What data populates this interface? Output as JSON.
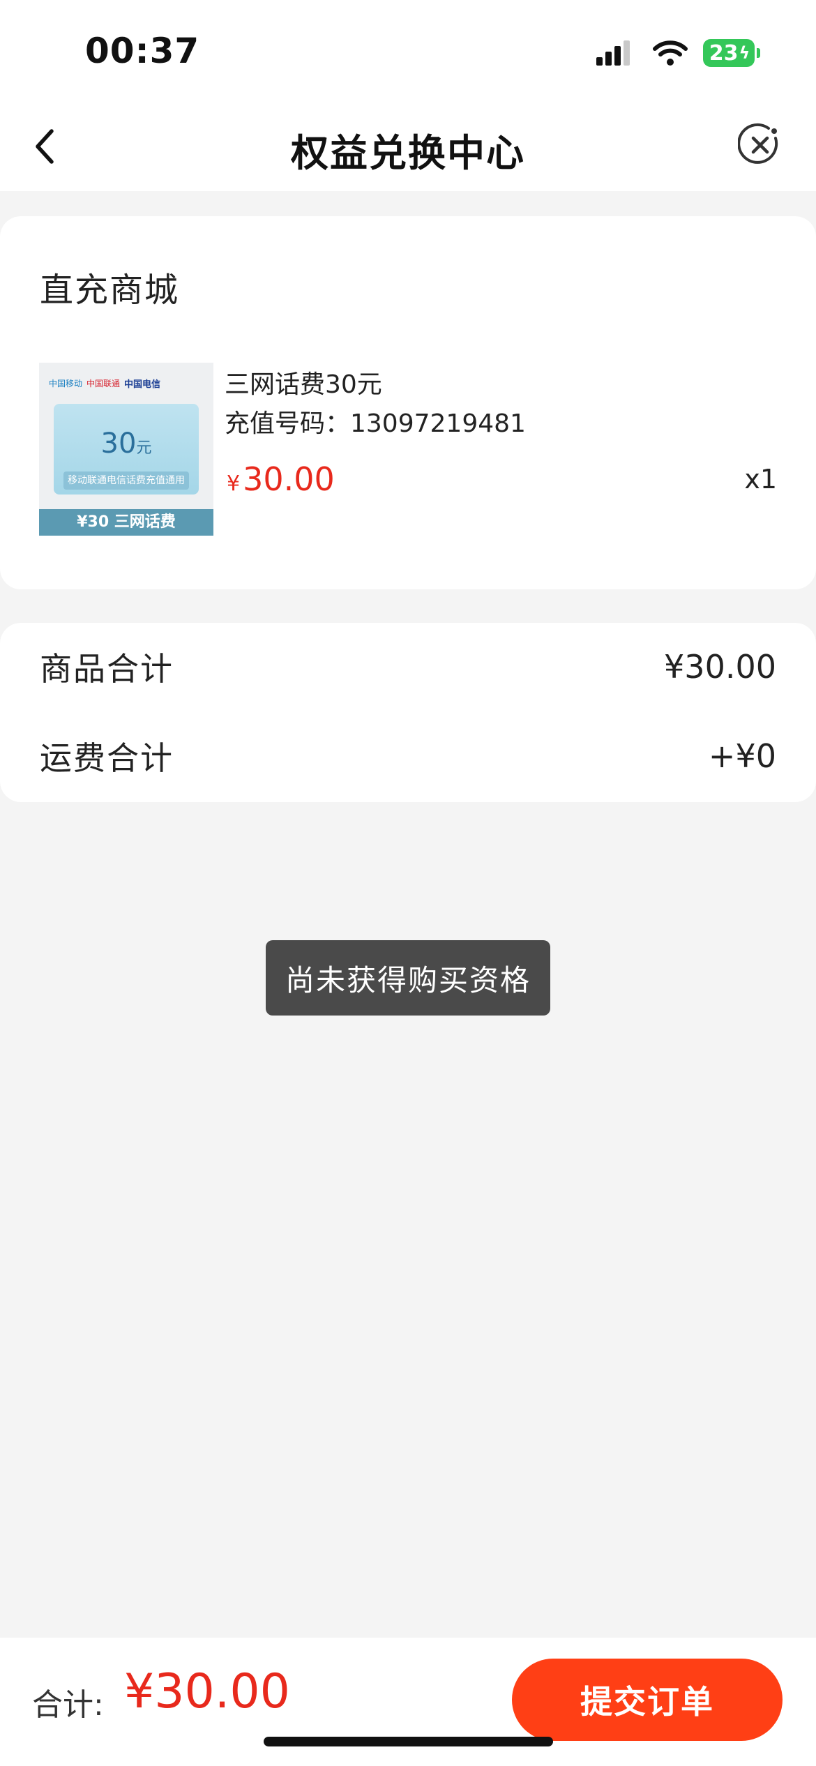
{
  "status_bar": {
    "time": "00:37",
    "battery": "23"
  },
  "nav": {
    "title": "权益兑换中心"
  },
  "product_section": {
    "title": "直充商城",
    "image": {
      "face_value": "30",
      "face_unit": "元",
      "note": "移动联通电信话费充值通用",
      "band": "¥30 三网话费",
      "logo_cm": "中国移动",
      "logo_cu": "中国联通",
      "logo_ct": "中国电信"
    },
    "name": "三网话费30元",
    "recharge_number": "充值号码：13097219481",
    "price_symbol": "¥",
    "price": "30.00",
    "quantity": "x1"
  },
  "summary": {
    "goods_label": "商品合计",
    "goods_value": "¥30.00",
    "shipping_label": "运费合计",
    "shipping_value": "+¥0"
  },
  "toast": {
    "message": "尚未获得购买资格"
  },
  "bottom_bar": {
    "total_label": "合计:",
    "total_amount": "¥30.00",
    "submit_label": "提交订单"
  }
}
